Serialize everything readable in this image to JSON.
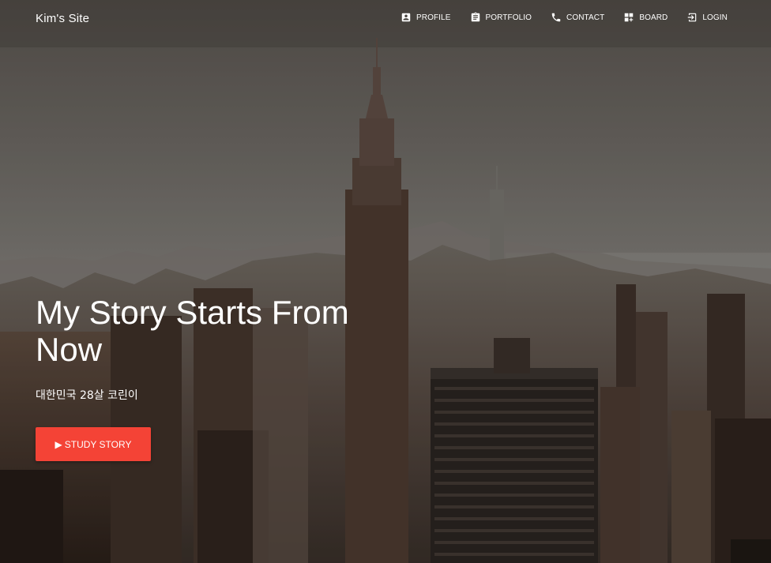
{
  "brand": "Kim's Site",
  "nav": [
    {
      "label": "PROFILE",
      "icon": "account-box-icon"
    },
    {
      "label": "PORTFOLIO",
      "icon": "assignment-icon"
    },
    {
      "label": "CONTACT",
      "icon": "phone-icon"
    },
    {
      "label": "BOARD",
      "icon": "dashboard-add-icon"
    },
    {
      "label": "LOGIN",
      "icon": "login-icon"
    }
  ],
  "hero": {
    "title": "My Story Starts From Now",
    "subtitle": "대한민국 28살 코린이",
    "button": {
      "icon": "▶",
      "label": "STUDY STORY"
    }
  },
  "colors": {
    "accent": "#f44336",
    "text": "#ffffff"
  }
}
